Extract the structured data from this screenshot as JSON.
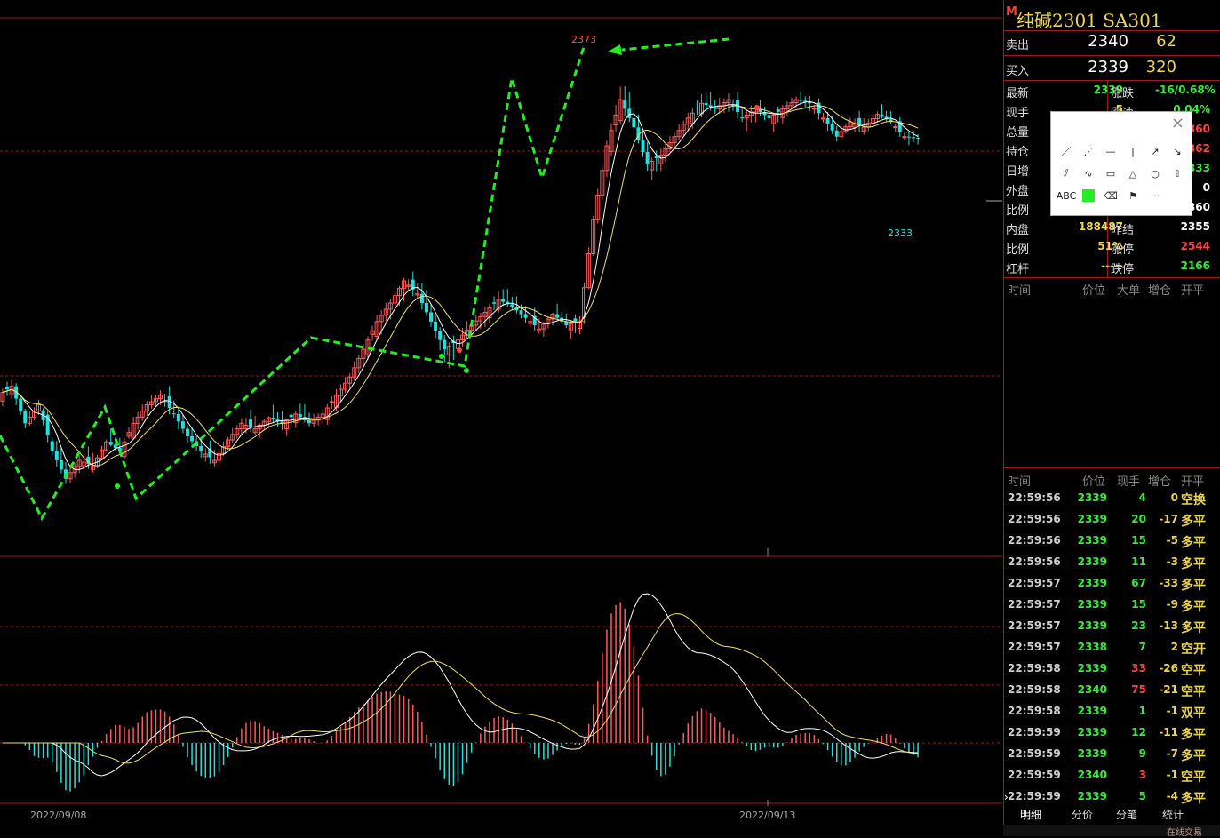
{
  "colors": {
    "up": "#ff5a5a",
    "down": "#22e0e0",
    "ma_white": "#ffffff",
    "ma_yellow": "#f0e060",
    "trend_green": "#22ee22",
    "grid": "#a01818",
    "title": "#f0d64e",
    "green_val": "#33ee33",
    "red_val": "#ff4444",
    "yellow_val": "#f0d64e"
  },
  "chart": {
    "high_label": "2373",
    "low_label": "2333",
    "x_labels": [
      "2022/09/08",
      "2022/09/13"
    ]
  },
  "chart_data": {
    "type": "candlestick",
    "symbol": "纯碱2301 SA301",
    "candles": [
      [
        2200,
        2210,
        2195,
        2205
      ],
      [
        2205,
        2208,
        2180,
        2185
      ],
      [
        2185,
        2200,
        2182,
        2195
      ],
      [
        2195,
        2198,
        2165,
        2170
      ],
      [
        2170,
        2180,
        2150,
        2155
      ],
      [
        2155,
        2170,
        2150,
        2165
      ],
      [
        2165,
        2175,
        2158,
        2162
      ],
      [
        2162,
        2178,
        2160,
        2175
      ],
      [
        2175,
        2185,
        2168,
        2170
      ],
      [
        2170,
        2190,
        2168,
        2185
      ],
      [
        2185,
        2200,
        2180,
        2195
      ],
      [
        2195,
        2205,
        2190,
        2200
      ],
      [
        2200,
        2210,
        2185,
        2190
      ],
      [
        2190,
        2195,
        2172,
        2178
      ],
      [
        2178,
        2185,
        2165,
        2170
      ],
      [
        2170,
        2178,
        2160,
        2165
      ],
      [
        2165,
        2180,
        2162,
        2176
      ],
      [
        2176,
        2190,
        2172,
        2185
      ],
      [
        2185,
        2195,
        2178,
        2182
      ],
      [
        2182,
        2190,
        2175,
        2188
      ],
      [
        2188,
        2198,
        2180,
        2185
      ],
      [
        2185,
        2192,
        2178,
        2190
      ],
      [
        2190,
        2200,
        2182,
        2185
      ],
      [
        2185,
        2195,
        2180,
        2190
      ],
      [
        2190,
        2205,
        2185,
        2200
      ],
      [
        2200,
        2215,
        2195,
        2210
      ],
      [
        2210,
        2230,
        2205,
        2225
      ],
      [
        2225,
        2245,
        2220,
        2240
      ],
      [
        2240,
        2255,
        2230,
        2250
      ],
      [
        2250,
        2265,
        2240,
        2262
      ],
      [
        2262,
        2270,
        2250,
        2255
      ],
      [
        2255,
        2265,
        2235,
        2240
      ],
      [
        2240,
        2245,
        2215,
        2225
      ],
      [
        2225,
        2235,
        2212,
        2230
      ],
      [
        2230,
        2245,
        2225,
        2238
      ],
      [
        2238,
        2250,
        2230,
        2245
      ],
      [
        2245,
        2258,
        2240,
        2252
      ],
      [
        2252,
        2262,
        2245,
        2248
      ],
      [
        2248,
        2256,
        2238,
        2242
      ],
      [
        2242,
        2250,
        2232,
        2236
      ],
      [
        2236,
        2246,
        2230,
        2244
      ],
      [
        2244,
        2252,
        2236,
        2238
      ],
      [
        2238,
        2244,
        2230,
        2240
      ],
      [
        2240,
        2300,
        2238,
        2295
      ],
      [
        2295,
        2340,
        2290,
        2335
      ],
      [
        2335,
        2370,
        2330,
        2360
      ],
      [
        2360,
        2373,
        2340,
        2345
      ],
      [
        2345,
        2355,
        2320,
        2325
      ],
      [
        2325,
        2335,
        2315,
        2330
      ],
      [
        2330,
        2345,
        2325,
        2340
      ],
      [
        2340,
        2355,
        2335,
        2350
      ],
      [
        2350,
        2365,
        2345,
        2358
      ],
      [
        2358,
        2368,
        2350,
        2355
      ],
      [
        2355,
        2366,
        2348,
        2360
      ],
      [
        2360,
        2368,
        2345,
        2350
      ],
      [
        2350,
        2360,
        2340,
        2355
      ],
      [
        2355,
        2362,
        2345,
        2350
      ],
      [
        2350,
        2358,
        2342,
        2355
      ],
      [
        2355,
        2364,
        2350,
        2360
      ],
      [
        2360,
        2366,
        2352,
        2358
      ],
      [
        2358,
        2362,
        2345,
        2350
      ],
      [
        2350,
        2356,
        2335,
        2340
      ],
      [
        2340,
        2352,
        2338,
        2348
      ],
      [
        2348,
        2355,
        2340,
        2345
      ],
      [
        2345,
        2356,
        2342,
        2352
      ],
      [
        2352,
        2360,
        2346,
        2348
      ],
      [
        2348,
        2352,
        2336,
        2340
      ],
      [
        2340,
        2345,
        2333,
        2339
      ]
    ]
  },
  "sidebar": {
    "title_mark": "M",
    "title": "纯碱2301  SA301",
    "sell": {
      "label": "卖出",
      "price": "2340",
      "vol": "62"
    },
    "buy": {
      "label": "买入",
      "price": "2339",
      "vol": "320"
    },
    "quotes": [
      {
        "l": "最新",
        "v": "2339",
        "vc": "green",
        "l2": "涨跌",
        "v2": "-16/0.68%",
        "v2c": "green"
      },
      {
        "l": "现手",
        "v": "5",
        "vc": "yellow",
        "l2": "涨速",
        "v2": "0.04%",
        "v2c": "green"
      },
      {
        "l": "总量",
        "v": "",
        "vc": "yellow",
        "l2": "",
        "v2": "360",
        "v2c": "red"
      },
      {
        "l": "持仓",
        "v": "",
        "vc": "yellow",
        "l2": "",
        "v2": "362",
        "v2c": "red"
      },
      {
        "l": "日增",
        "v": "",
        "vc": "yellow",
        "l2": "",
        "v2": "333",
        "v2c": "green"
      },
      {
        "l": "外盘",
        "v": "",
        "vc": "yellow",
        "l2": "",
        "v2": "0",
        "v2c": "white"
      },
      {
        "l": "比例",
        "v": "",
        "vc": "yellow",
        "l2": "",
        "v2": "360",
        "v2c": "white"
      },
      {
        "l": "内盘",
        "v": "188487",
        "vc": "yellow",
        "l2": "昨结",
        "v2": "2355",
        "v2c": "white"
      },
      {
        "l": "比例",
        "v": "51%",
        "vc": "yellow",
        "l2": "涨停",
        "v2": "2544",
        "v2c": "red"
      },
      {
        "l": "杠杆",
        "v": "-----",
        "vc": "yellow",
        "l2": "跌停",
        "v2": "2166",
        "v2c": "green"
      }
    ],
    "big_header": {
      "time": "时间",
      "price": "价位",
      "big": "大单",
      "inc": "增仓",
      "oc": "开平"
    },
    "tick_header": {
      "time": "时间",
      "price": "价位",
      "vol": "现手",
      "inc": "增仓",
      "oc": "开平"
    },
    "ticks": [
      {
        "t": "22:59:56",
        "p": "2339",
        "v": "4",
        "i": "0",
        "k": "空换",
        "vc": "green",
        "ic": "yellow"
      },
      {
        "t": "22:59:56",
        "p": "2339",
        "v": "20",
        "i": "-17",
        "k": "多平",
        "vc": "green",
        "ic": "yellow"
      },
      {
        "t": "22:59:56",
        "p": "2339",
        "v": "15",
        "i": "-5",
        "k": "多平",
        "vc": "green",
        "ic": "yellow"
      },
      {
        "t": "22:59:56",
        "p": "2339",
        "v": "11",
        "i": "-3",
        "k": "多平",
        "vc": "green",
        "ic": "yellow"
      },
      {
        "t": "22:59:57",
        "p": "2339",
        "v": "67",
        "i": "-33",
        "k": "多平",
        "vc": "green",
        "ic": "yellow"
      },
      {
        "t": "22:59:57",
        "p": "2339",
        "v": "15",
        "i": "-9",
        "k": "多平",
        "vc": "green",
        "ic": "yellow"
      },
      {
        "t": "22:59:57",
        "p": "2339",
        "v": "23",
        "i": "-13",
        "k": "多平",
        "vc": "green",
        "ic": "yellow"
      },
      {
        "t": "22:59:57",
        "p": "2338",
        "v": "7",
        "i": "2",
        "k": "空开",
        "vc": "green",
        "ic": "yellow"
      },
      {
        "t": "22:59:58",
        "p": "2339",
        "v": "33",
        "i": "-26",
        "k": "空平",
        "vc": "red",
        "ic": "yellow"
      },
      {
        "t": "22:59:58",
        "p": "2340",
        "v": "75",
        "i": "-21",
        "k": "空平",
        "vc": "red",
        "ic": "yellow"
      },
      {
        "t": "22:59:58",
        "p": "2339",
        "v": "1",
        "i": "-1",
        "k": "双平",
        "vc": "green",
        "ic": "yellow"
      },
      {
        "t": "22:59:59",
        "p": "2339",
        "v": "12",
        "i": "-11",
        "k": "多平",
        "vc": "green",
        "ic": "yellow"
      },
      {
        "t": "22:59:59",
        "p": "2339",
        "v": "9",
        "i": "-7",
        "k": "多平",
        "vc": "green",
        "ic": "yellow"
      },
      {
        "t": "22:59:59",
        "p": "2340",
        "v": "3",
        "i": "-1",
        "k": "空平",
        "vc": "red",
        "ic": "yellow"
      },
      {
        "t": "22:59:59",
        "p": "2339",
        "v": "5",
        "i": "-4",
        "k": "多平",
        "vc": "green",
        "ic": "yellow"
      }
    ],
    "tabs": [
      "明细",
      "分价",
      "分笔",
      "统计"
    ],
    "status": "在线交易"
  },
  "toolbox": {
    "close_icon": "close-icon",
    "tools": [
      "line-icon",
      "dashed-line-icon",
      "horizontal-line-icon",
      "vertical-line-icon",
      "arrow-up-right-icon",
      "arrow-down-right-icon",
      "parallel-lines-icon",
      "zigzag-icon",
      "rectangle-icon",
      "triangle-icon",
      "ellipse-icon",
      "up-arrow-icon",
      "text-icon",
      "color-swatch-icon",
      "eraser-icon",
      "flag-icon",
      "more-icon"
    ],
    "text_tool_label": "ABC",
    "more_label": "···"
  }
}
